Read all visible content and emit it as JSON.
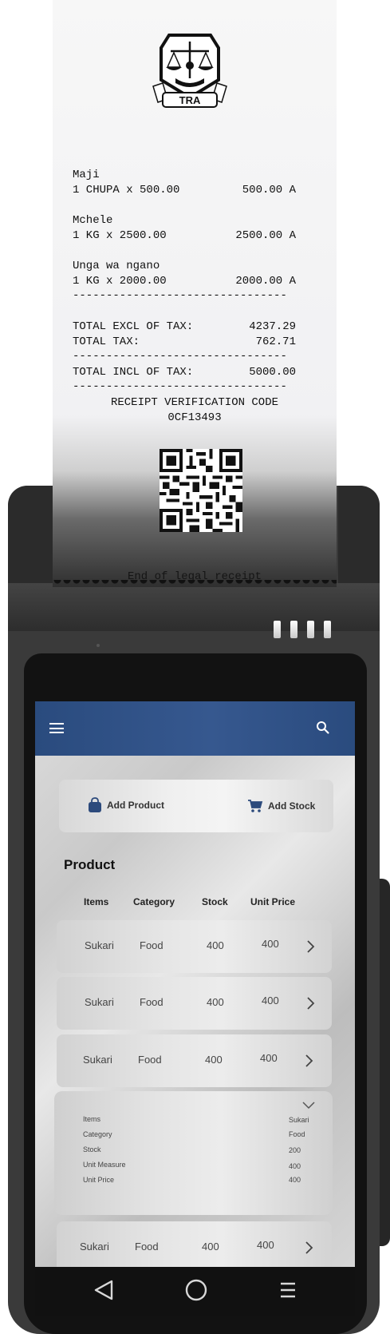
{
  "receipt": {
    "items": [
      {
        "name": "Maji",
        "line": "1 CHUPA x 500.00",
        "total": "500.00 A"
      },
      {
        "name": "Mchele",
        "line": "1 KG x 2500.00",
        "total": "2500.00 A"
      },
      {
        "name": "Unga wa ngano",
        "line": "1 KG x 2000.00",
        "total": "2000.00 A"
      }
    ],
    "dashes": "--------------------------------",
    "excl_label": "TOTAL EXCL OF TAX:",
    "excl_value": "4237.29",
    "tax_label": "TOTAL TAX:",
    "tax_value": "762.71",
    "incl_label": "TOTAL INCL OF TAX:",
    "incl_value": "5000.00",
    "verification_label": "RECEIPT VERIFICATION CODE",
    "verification_code": "0CF13493",
    "end_text": "End of legal receipt",
    "logo_text": "TRA"
  },
  "actions": {
    "add_product": "Add Product",
    "add_stock": "Add Stock"
  },
  "section_title": "Product",
  "columns": [
    "Items",
    "Category",
    "Stock",
    "Unit Price"
  ],
  "rows": [
    {
      "item": "Sukari",
      "category": "Food",
      "stock": "400",
      "price": "400"
    },
    {
      "item": "Sukari",
      "category": "Food",
      "stock": "400",
      "price": "400"
    },
    {
      "item": "Sukari",
      "category": "Food",
      "stock": "400",
      "price": "400"
    },
    {
      "item": "Sukari",
      "category": "Food",
      "stock": "400",
      "price": "400"
    }
  ],
  "detail": {
    "labels": [
      "Items",
      "Category",
      "Stock",
      "Unit Measure",
      "Unit Price"
    ],
    "values": [
      "Sukari",
      "Food",
      "200",
      "400",
      "400"
    ]
  },
  "colors": {
    "app_bar": "#2f5189",
    "icon_blue": "#2c4a7c"
  }
}
